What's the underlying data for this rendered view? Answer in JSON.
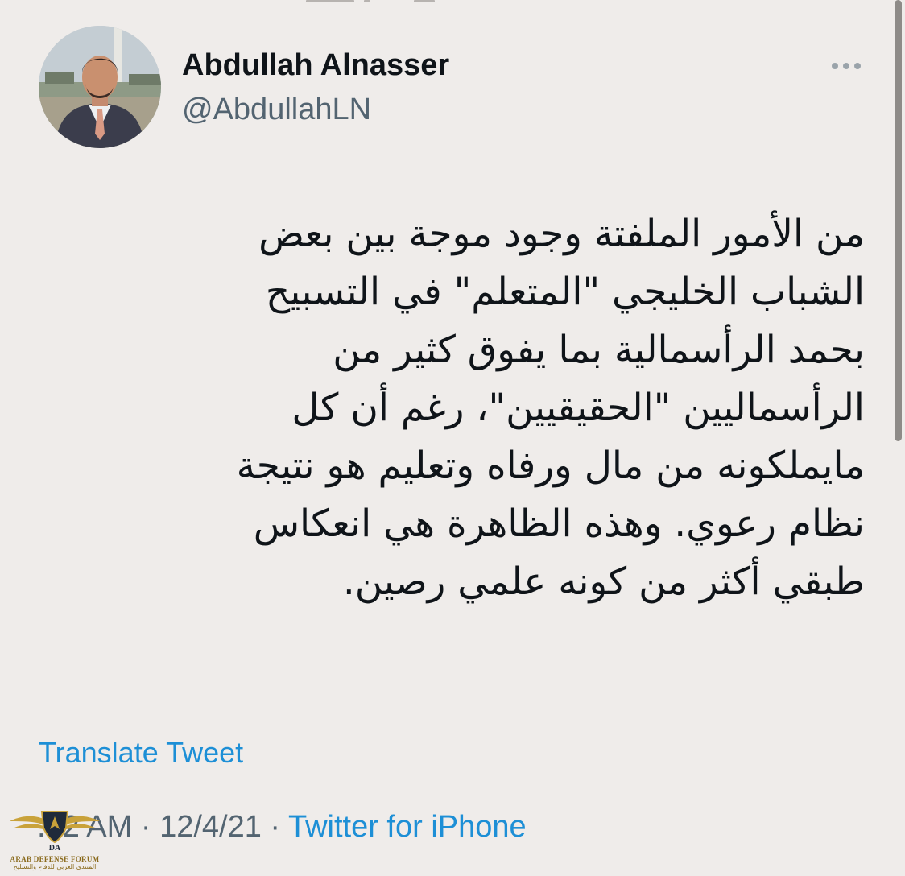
{
  "author": {
    "display_name": "Abdullah Alnasser",
    "handle": "@AbdullahLN",
    "avatar_icon": "profile-photo"
  },
  "more_icon": "more-options-icon",
  "tweet": {
    "text": "من الأمور الملفتة وجود موجة بين بعض\nالشباب الخليجي \"المتعلم\"  في التسبيح\nبحمد الرأسمالية بما يفوق كثير من\nالرأسماليين \"الحقيقيين\"، رغم أن كل\nمايملكونه من مال ورفاه وتعليم هو نتيجة\nنظام رعوي. وهذه الظاهرة هي انعكاس\nطبقي أكثر من كونه علمي رصين."
  },
  "translate_label": "Translate Tweet",
  "meta": {
    "time": ":32 AM",
    "separator": " · ",
    "date": "12/4/21",
    "source": "Twitter for iPhone"
  },
  "watermark": {
    "title": "ARAB DEFENSE FORUM",
    "subtitle": "المنتدى العربي للدفاع والتسليح",
    "monogram": "DA"
  },
  "colors": {
    "background": "#efecea",
    "link": "#1d8fd6",
    "secondary_text": "#536471",
    "primary_text": "#0f1419"
  }
}
